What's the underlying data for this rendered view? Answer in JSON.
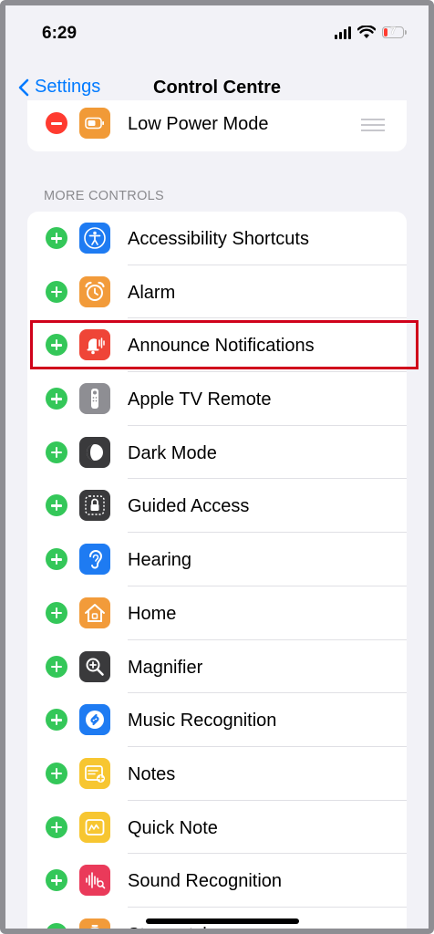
{
  "status_bar": {
    "time": "6:29",
    "battery_level": "7"
  },
  "nav": {
    "back_label": "Settings",
    "title": "Control Centre"
  },
  "included": [
    {
      "label": "Low Power Mode",
      "icon": "battery-icon",
      "color": "#f19a37"
    }
  ],
  "section_header": "MORE CONTROLS",
  "more_controls": [
    {
      "label": "Accessibility Shortcuts",
      "icon": "accessibility-icon",
      "color": "#1e7bf2"
    },
    {
      "label": "Alarm",
      "icon": "alarm-clock-icon",
      "color": "#f29b3a"
    },
    {
      "label": "Announce Notifications",
      "icon": "announce-bell-icon",
      "color": "#ef4537"
    },
    {
      "label": "Apple TV Remote",
      "icon": "tv-remote-icon",
      "color": "#8e8e93"
    },
    {
      "label": "Dark Mode",
      "icon": "dark-mode-icon",
      "color": "#3a3a3c"
    },
    {
      "label": "Guided Access",
      "icon": "lock-icon",
      "color": "#3a3a3c"
    },
    {
      "label": "Hearing",
      "icon": "ear-icon",
      "color": "#1e7bf2"
    },
    {
      "label": "Home",
      "icon": "home-icon",
      "color": "#f29b3a"
    },
    {
      "label": "Magnifier",
      "icon": "magnifier-icon",
      "color": "#3a3a3c"
    },
    {
      "label": "Music Recognition",
      "icon": "shazam-icon",
      "color": "#1e7bf2"
    },
    {
      "label": "Notes",
      "icon": "notes-icon",
      "color": "#f7c631"
    },
    {
      "label": "Quick Note",
      "icon": "quick-note-icon",
      "color": "#f7c631"
    },
    {
      "label": "Sound Recognition",
      "icon": "waveform-icon",
      "color": "#ea3a5a"
    },
    {
      "label": "Stopwatch",
      "icon": "stopwatch-icon",
      "color": "#f29b3a"
    }
  ],
  "highlighted_item": "Announce Notifications"
}
